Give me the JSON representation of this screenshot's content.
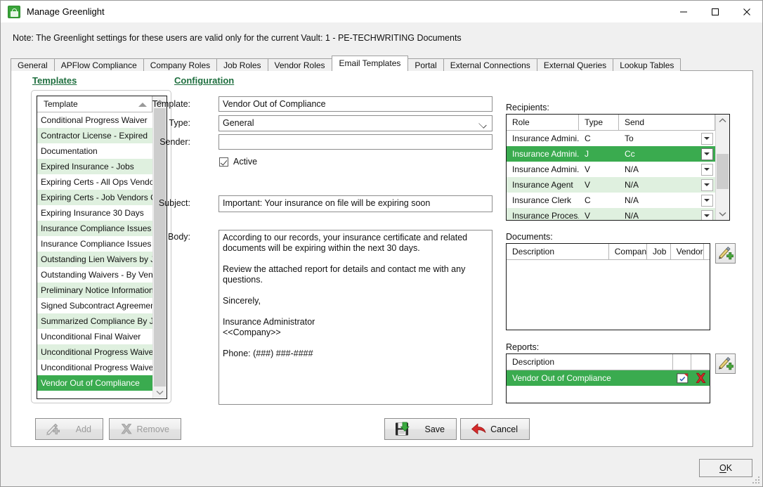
{
  "window": {
    "title": "Manage Greenlight",
    "icon": "greenlight-app-icon",
    "minimize": "minimize-icon",
    "maximize": "maximize-icon",
    "close": "close-icon"
  },
  "note": {
    "text": "Note:  The Greenlight settings for these users are valid only for the current Vault: 1 - PE-TECHWRITING Documents"
  },
  "tabs": [
    {
      "label": "General",
      "active": false
    },
    {
      "label": "APFlow Compliance",
      "active": false
    },
    {
      "label": "Company Roles",
      "active": false
    },
    {
      "label": "Job Roles",
      "active": false
    },
    {
      "label": "Vendor Roles",
      "active": false
    },
    {
      "label": "Email Templates",
      "active": true
    },
    {
      "label": "Portal",
      "active": false
    },
    {
      "label": "External Connections",
      "active": false
    },
    {
      "label": "External Queries",
      "active": false
    },
    {
      "label": "Lookup Tables",
      "active": false
    }
  ],
  "templates_panel": {
    "heading": "Templates",
    "column_header": "Template",
    "sort_indicator": "sort-ascending-icon",
    "items": [
      "Conditional Progress Waiver",
      "Contractor License - Expired",
      "Documentation",
      "Expired Insurance - Jobs",
      "Expiring Certs - All Ops Vendor",
      "Expiring Certs - Job Vendors Only",
      "Expiring Insurance 30 Days",
      "Insurance Compliance Issues - ...",
      "Insurance Compliance Issues - ...",
      "Outstanding Lien Waivers by Job",
      "Outstanding Waivers - By Vend...",
      "Preliminary Notice Information",
      "Signed Subcontract Agreement",
      "Summarized Compliance By Job",
      "Unconditional Final Waiver",
      "Unconditional Progress Waiver",
      "Unconditional Progress Waiver ...",
      "Vendor Out of Compliance"
    ],
    "selected_index": 17,
    "add_label": "Add",
    "add_icon": "pen-plus-icon",
    "remove_label": "Remove",
    "remove_icon": "x-mark-icon"
  },
  "configuration": {
    "heading": "Configuration",
    "template_label": "Template:",
    "template_value": "Vendor Out of Compliance",
    "type_label": "Type:",
    "type_value": "General",
    "type_chevron": "chevron-down-icon",
    "sender_label": "Sender:",
    "sender_value": "",
    "active_label": "Active",
    "active_checked": true,
    "subject_label": "Subject:",
    "subject_value": "Important: Your insurance on file will be expiring soon",
    "body_label": "Body:",
    "body_value": "According to our records, your insurance certificate and related documents will be expiring within the next 30 days.\n\nReview the attached report for details and contact me with any questions.\n\nSincerely,\n\nInsurance Administrator\n<<Company>>\n\nPhone: (###) ###-####",
    "save_label": "Save",
    "save_icon": "floppy-disk-save-icon",
    "cancel_label": "Cancel",
    "cancel_icon": "red-undo-arrow-icon"
  },
  "recipients": {
    "label": "Recipients:",
    "columns": [
      "Role",
      "Type",
      "Send"
    ],
    "rows": [
      {
        "role": "Insurance Admini...",
        "type": "C",
        "send": "To"
      },
      {
        "role": "Insurance Admini...",
        "type": "J",
        "send": "Cc"
      },
      {
        "role": "Insurance Admini...",
        "type": "V",
        "send": "N/A"
      },
      {
        "role": "Insurance Agent",
        "type": "V",
        "send": "N/A"
      },
      {
        "role": "Insurance Clerk",
        "type": "C",
        "send": "N/A"
      },
      {
        "role": "Insurance Proces...",
        "type": "V",
        "send": "N/A"
      }
    ],
    "selected_index": 1,
    "dropdown_icon": "dropdown-arrow-icon",
    "scroll_up_icon": "scroll-up-icon",
    "scroll_down_icon": "scroll-down-icon"
  },
  "documents": {
    "label": "Documents:",
    "columns": [
      "Description",
      "Company",
      "Job",
      "Vendor",
      ""
    ],
    "rows": [],
    "add_icon": "pen-plus-icon"
  },
  "reports": {
    "label": "Reports:",
    "columns": [
      "Description",
      "",
      ""
    ],
    "rows": [
      {
        "description": "Vendor Out of Compliance",
        "edit_icon": "edit-report-icon",
        "delete_icon": "red-x-delete-icon"
      }
    ],
    "selected_index": 0,
    "add_icon": "pen-plus-icon"
  },
  "footer": {
    "ok_label": "OK",
    "ok_mnemonic": "O",
    "ok_rest": "K"
  },
  "colors": {
    "accent_green": "#3aab4f",
    "alt_row_green": "#dff0df",
    "heading_green": "#1f6f3f",
    "window_chrome": "#f0f0f0"
  }
}
